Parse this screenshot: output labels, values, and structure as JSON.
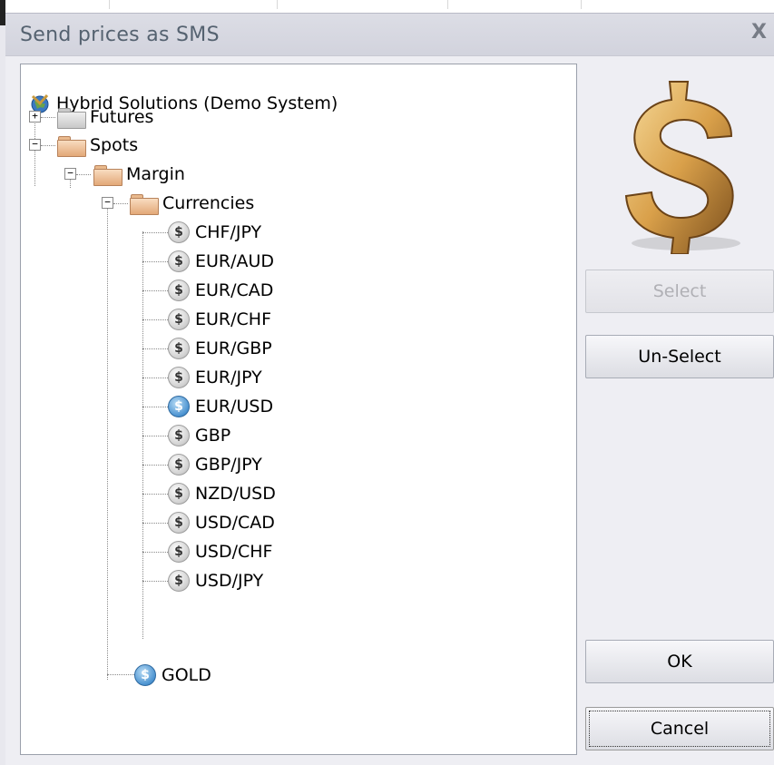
{
  "dialog": {
    "title": "Send prices as SMS",
    "close_glyph": "X"
  },
  "tree": {
    "root": {
      "label": "Hybrid Solutions (Demo System)",
      "icon": "globe-icon"
    },
    "futures": {
      "label": "Futures",
      "expander": "+",
      "icon": "gray-folder-icon"
    },
    "spots": {
      "label": "Spots",
      "expander": "−",
      "icon": "tan-folder-icon"
    },
    "margin": {
      "label": "Margin",
      "expander": "−",
      "icon": "tan-folder-icon"
    },
    "currencies": {
      "label": "Currencies",
      "expander": "−",
      "icon": "tan-folder-icon"
    },
    "symbols": [
      {
        "label": "CHF/JPY",
        "selected": false
      },
      {
        "label": "EUR/AUD",
        "selected": false
      },
      {
        "label": "EUR/CAD",
        "selected": false
      },
      {
        "label": "EUR/CHF",
        "selected": false
      },
      {
        "label": "EUR/GBP",
        "selected": false
      },
      {
        "label": "EUR/JPY",
        "selected": false
      },
      {
        "label": "EUR/USD",
        "selected": true
      },
      {
        "label": "GBP",
        "selected": false
      },
      {
        "label": "GBP/JPY",
        "selected": false
      },
      {
        "label": "NZD/USD",
        "selected": false
      },
      {
        "label": "USD/CAD",
        "selected": false
      },
      {
        "label": "USD/CHF",
        "selected": false
      },
      {
        "label": "USD/JPY",
        "selected": false
      }
    ],
    "gold": {
      "label": "GOLD",
      "selected": true
    },
    "coin_glyph": "$"
  },
  "buttons": {
    "select": {
      "label": "Select",
      "enabled": false
    },
    "unselect": {
      "label": "Un-Select",
      "enabled": true
    },
    "ok": {
      "label": "OK"
    },
    "cancel": {
      "label": "Cancel",
      "focused": true
    }
  },
  "colors": {
    "selected_coin": "#4b93d1",
    "unselected_coin": "#cfcfcf",
    "dollar_gold": "#c8913d"
  }
}
